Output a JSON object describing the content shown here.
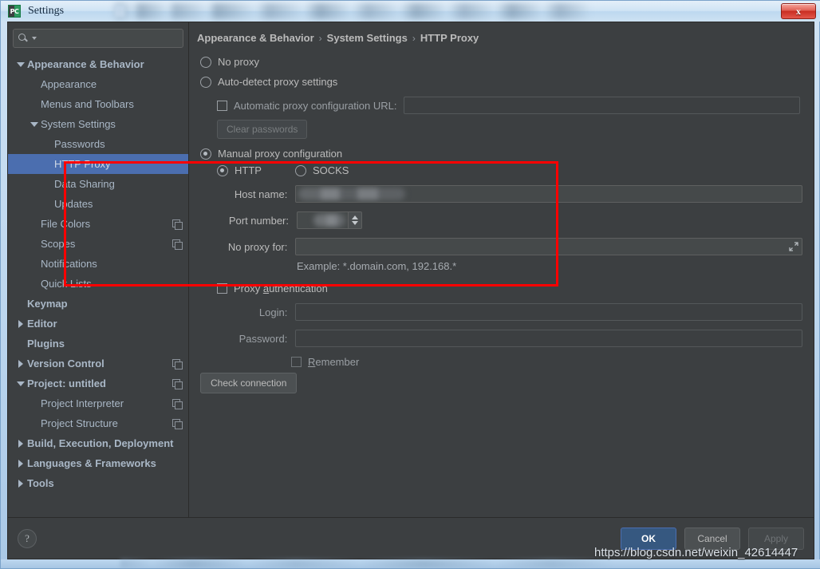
{
  "window": {
    "app_icon": "PC",
    "title": "Settings",
    "close_label": "x",
    "close_icon": "close-icon"
  },
  "sidebar": {
    "search": {
      "placeholder": "",
      "value": "",
      "icon": "search-icon",
      "caret_icon": "chevron-down-icon"
    },
    "items": [
      {
        "label": "Appearance & Behavior",
        "indent": 0,
        "twisty": "open",
        "bold": true,
        "copy": false,
        "selected": false
      },
      {
        "label": "Appearance",
        "indent": 1,
        "twisty": "none",
        "bold": false,
        "copy": false,
        "selected": false
      },
      {
        "label": "Menus and Toolbars",
        "indent": 1,
        "twisty": "none",
        "bold": false,
        "copy": false,
        "selected": false
      },
      {
        "label": "System Settings",
        "indent": 1,
        "twisty": "open",
        "bold": false,
        "copy": false,
        "selected": false
      },
      {
        "label": "Passwords",
        "indent": 2,
        "twisty": "none",
        "bold": false,
        "copy": false,
        "selected": false
      },
      {
        "label": "HTTP Proxy",
        "indent": 2,
        "twisty": "none",
        "bold": false,
        "copy": false,
        "selected": true
      },
      {
        "label": "Data Sharing",
        "indent": 2,
        "twisty": "none",
        "bold": false,
        "copy": false,
        "selected": false
      },
      {
        "label": "Updates",
        "indent": 2,
        "twisty": "none",
        "bold": false,
        "copy": false,
        "selected": false
      },
      {
        "label": "File Colors",
        "indent": 1,
        "twisty": "none",
        "bold": false,
        "copy": true,
        "selected": false
      },
      {
        "label": "Scopes",
        "indent": 1,
        "twisty": "none",
        "bold": false,
        "copy": true,
        "selected": false
      },
      {
        "label": "Notifications",
        "indent": 1,
        "twisty": "none",
        "bold": false,
        "copy": false,
        "selected": false
      },
      {
        "label": "Quick Lists",
        "indent": 1,
        "twisty": "none",
        "bold": false,
        "copy": false,
        "selected": false
      },
      {
        "label": "Keymap",
        "indent": 0,
        "twisty": "none",
        "bold": true,
        "copy": false,
        "selected": false
      },
      {
        "label": "Editor",
        "indent": 0,
        "twisty": "closed",
        "bold": true,
        "copy": false,
        "selected": false
      },
      {
        "label": "Plugins",
        "indent": 0,
        "twisty": "none",
        "bold": true,
        "copy": false,
        "selected": false
      },
      {
        "label": "Version Control",
        "indent": 0,
        "twisty": "closed",
        "bold": true,
        "copy": true,
        "selected": false
      },
      {
        "label": "Project: untitled",
        "indent": 0,
        "twisty": "open",
        "bold": true,
        "copy": true,
        "selected": false
      },
      {
        "label": "Project Interpreter",
        "indent": 1,
        "twisty": "none",
        "bold": false,
        "copy": true,
        "selected": false
      },
      {
        "label": "Project Structure",
        "indent": 1,
        "twisty": "none",
        "bold": false,
        "copy": true,
        "selected": false
      },
      {
        "label": "Build, Execution, Deployment",
        "indent": 0,
        "twisty": "closed",
        "bold": true,
        "copy": false,
        "selected": false
      },
      {
        "label": "Languages & Frameworks",
        "indent": 0,
        "twisty": "closed",
        "bold": true,
        "copy": false,
        "selected": false
      },
      {
        "label": "Tools",
        "indent": 0,
        "twisty": "closed",
        "bold": true,
        "copy": false,
        "selected": false
      }
    ]
  },
  "breadcrumb": {
    "part1": "Appearance & Behavior",
    "sep1": "›",
    "part2": "System Settings",
    "sep2": "›",
    "part3": "HTTP Proxy"
  },
  "main": {
    "no_proxy_label": "No proxy",
    "no_proxy_selected": false,
    "auto_detect_label": "Auto-detect proxy settings",
    "auto_detect_selected": false,
    "auto_url_checkbox_label": "Automatic proxy configuration URL:",
    "auto_url_checked": false,
    "auto_url_value": "",
    "clear_passwords_label": "Clear passwords",
    "clear_passwords_enabled": false,
    "manual_label": "Manual proxy configuration",
    "manual_selected": true,
    "http_label": "HTTP",
    "http_selected": true,
    "socks_label": "SOCKS",
    "socks_selected": false,
    "host_label": "Host name:",
    "host_value": "",
    "host_redacted": true,
    "port_label": "Port number:",
    "port_value": "",
    "port_redacted": true,
    "no_proxy_for_label": "No proxy for:",
    "no_proxy_for_value": "",
    "expand_icon": "expand-icon",
    "example_text": "Example: *.domain.com, 192.168.*",
    "proxy_auth_label_pre": "Proxy ",
    "proxy_auth_label_underline": "a",
    "proxy_auth_label_post": "uthentication",
    "proxy_auth_checked": false,
    "login_label": "Login:",
    "login_value": "",
    "password_label": "Password:",
    "password_value": "",
    "remember_label_underline": "R",
    "remember_label_post": "emember",
    "remember_checked": false,
    "check_connection_label": "Check connection"
  },
  "footer": {
    "help_label": "?",
    "help_icon": "help-icon",
    "ok_label": "OK",
    "cancel_label": "Cancel",
    "apply_label": "Apply",
    "apply_enabled": false
  },
  "watermark": {
    "text": "https://blog.csdn.net/weixin_42614447"
  },
  "colors": {
    "accent": "#4b6eaf",
    "primary_button": "#365880",
    "annotation": "#ff0000",
    "panel_bg": "#3c3f41",
    "text": "#bbbbbb"
  }
}
